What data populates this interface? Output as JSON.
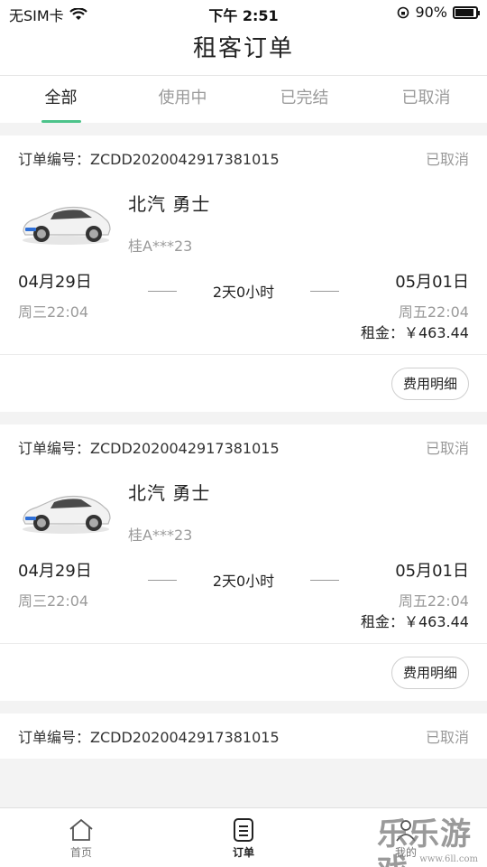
{
  "status_bar": {
    "carrier": "无SIM卡",
    "time": "下午 2:51",
    "battery": "90%",
    "battery_level": 0.9
  },
  "nav": {
    "title": "租客订单"
  },
  "tabs": [
    {
      "label": "全部",
      "active": true
    },
    {
      "label": "使用中",
      "active": false
    },
    {
      "label": "已完结",
      "active": false
    },
    {
      "label": "已取消",
      "active": false
    }
  ],
  "orders": [
    {
      "order_no": "订单编号：ZCDD2020042917381015",
      "status": "已取消",
      "car_name": "北汽 勇士",
      "plate": "桂A***23",
      "start_date": "04月29日",
      "start_weekday": "周三22:04",
      "duration": "2天0小时",
      "end_date": "05月01日",
      "end_weekday": "周五22:04",
      "rent": "租金：￥463.44",
      "detail_button": "费用明细"
    },
    {
      "order_no": "订单编号：ZCDD2020042917381015",
      "status": "已取消",
      "car_name": "北汽 勇士",
      "plate": "桂A***23",
      "start_date": "04月29日",
      "start_weekday": "周三22:04",
      "duration": "2天0小时",
      "end_date": "05月01日",
      "end_weekday": "周五22:04",
      "rent": "租金：￥463.44",
      "detail_button": "费用明细"
    },
    {
      "order_no": "订单编号：ZCDD2020042917381015",
      "status": "已取消"
    }
  ],
  "tab_bar": [
    {
      "label": "首页",
      "icon": "home-icon"
    },
    {
      "label": "订单",
      "icon": "order-list-icon"
    },
    {
      "label": "我的",
      "icon": "profile-icon"
    }
  ],
  "watermark": {
    "text": "乐乐游戏",
    "url": "www.6ll.com"
  },
  "colors": {
    "accent": "#4cc38a",
    "muted": "#9a9a9a"
  }
}
